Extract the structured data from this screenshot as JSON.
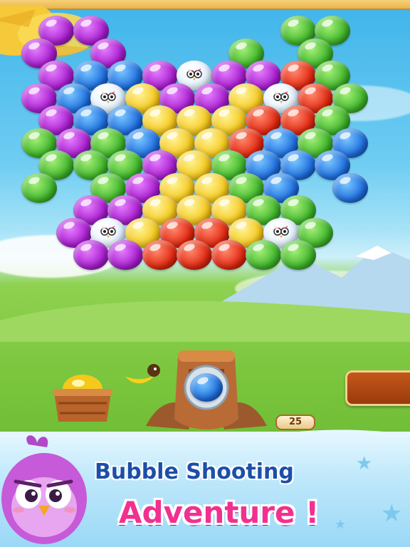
{
  "game": {
    "shots_left": "25",
    "tagline_line1": "Bubble Shooting",
    "tagline_line2": "Adventure !",
    "loaded_bubble": "blue",
    "basket_bubble": "yellow"
  },
  "colors": {
    "purple": "#a81ecf",
    "blue": "#1f6fe0",
    "green": "#3fb52a",
    "yellow": "#f5c81c",
    "red": "#e22810",
    "tagline_blue": "#1d4fa8",
    "tagline_pink": "#f1308f"
  },
  "bubbles": [
    [
      "purple",
      "purple",
      "",
      "",
      "",
      "",
      "",
      "green",
      "green",
      ""
    ],
    [
      "purple",
      "",
      "purple",
      "",
      "",
      "",
      "green",
      "",
      "green",
      ""
    ],
    [
      "purple",
      "blue",
      "blue",
      "purple",
      "bird",
      "purple",
      "purple",
      "red",
      "green",
      ""
    ],
    [
      "purple",
      "blue",
      "bird",
      "yellow",
      "purple",
      "purple",
      "yellow",
      "bird",
      "red",
      "green"
    ],
    [
      "purple",
      "blue",
      "blue",
      "yellow",
      "yellow",
      "yellow",
      "red",
      "red",
      "green",
      ""
    ],
    [
      "green",
      "purple",
      "green",
      "blue",
      "yellow",
      "yellow",
      "red",
      "blue",
      "green",
      "blue"
    ],
    [
      "green",
      "green",
      "green",
      "purple",
      "yellow",
      "green",
      "blue",
      "blue",
      "blue",
      ""
    ],
    [
      "green",
      "",
      "green",
      "purple",
      "yellow",
      "yellow",
      "green",
      "blue",
      "",
      "blue"
    ],
    [
      "",
      "purple",
      "purple",
      "yellow",
      "yellow",
      "yellow",
      "green",
      "green",
      "",
      ""
    ],
    [
      "",
      "purple",
      "bird",
      "yellow",
      "red",
      "red",
      "yellow",
      "bird",
      "green",
      ""
    ],
    [
      "",
      "purple",
      "purple",
      "red",
      "red",
      "red",
      "green",
      "green",
      "",
      ""
    ]
  ]
}
